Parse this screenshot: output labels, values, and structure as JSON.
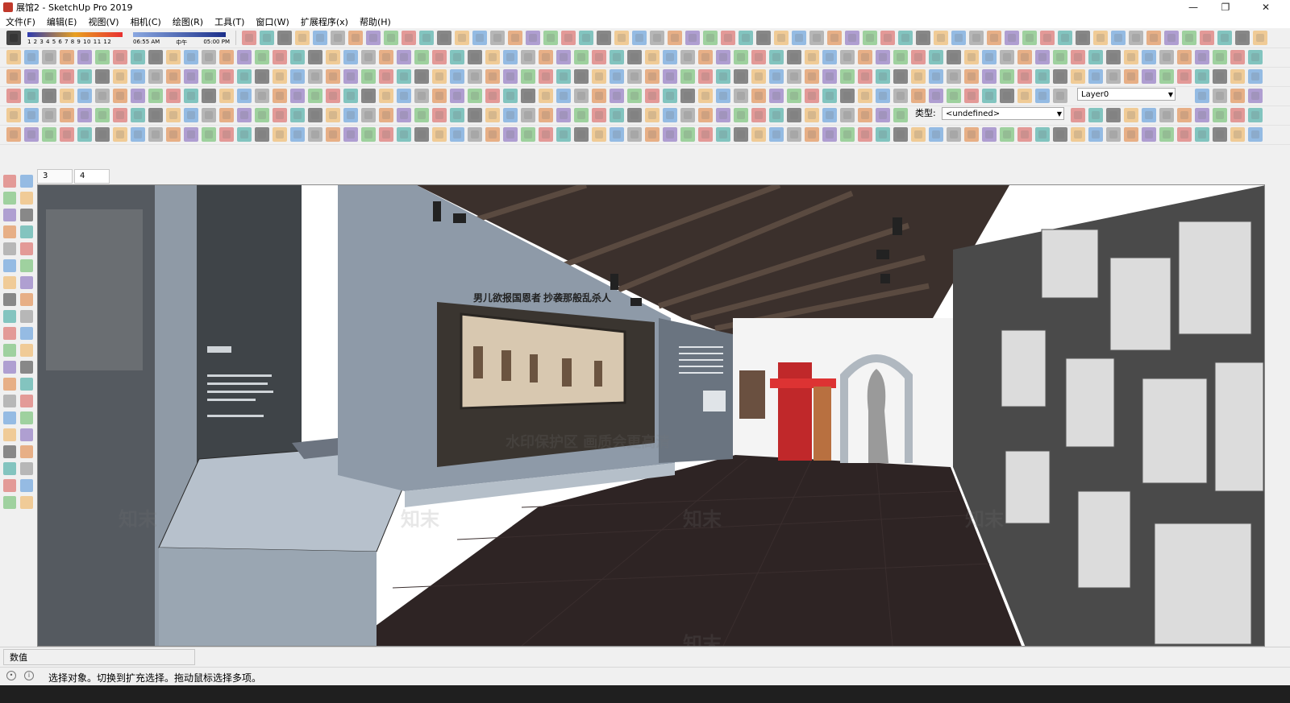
{
  "window": {
    "title": "展馆2 - SketchUp Pro 2019",
    "minimize_glyph": "—",
    "restore_glyph": "❐",
    "close_glyph": "✕"
  },
  "menu": [
    "文件(F)",
    "编辑(E)",
    "视图(V)",
    "相机(C)",
    "绘图(R)",
    "工具(T)",
    "窗口(W)",
    "扩展程序(x)",
    "帮助(H)"
  ],
  "shadow": {
    "months": "1 2 3 4 5 6 7 8 9 10 11 12",
    "time_start": "06:55 AM",
    "time_mid": "中午",
    "time_end": "05:00 PM"
  },
  "layer_select": {
    "value": "Layer0"
  },
  "type_field": {
    "label": "类型:",
    "value": "<undefined>"
  },
  "scene_tabs": [
    "3",
    "4"
  ],
  "viewport": {
    "exhibit_heading": "男儿欲报国恩者 抄袭那般乱杀人",
    "watermarks": [
      "水印保护区 画质会更高清",
      "知末",
      "知末",
      "知末",
      "知末",
      "知末"
    ],
    "background": "#ffffff"
  },
  "measurements": {
    "label": "数值"
  },
  "status": {
    "text": "选择对象。切换到扩充选择。拖动鼠标选择多项。"
  },
  "colors": {
    "ceiling": "#3b302c",
    "floor": "#2e2424",
    "panel_blue": "#7c8ea3",
    "accent_red": "#c0282a"
  }
}
